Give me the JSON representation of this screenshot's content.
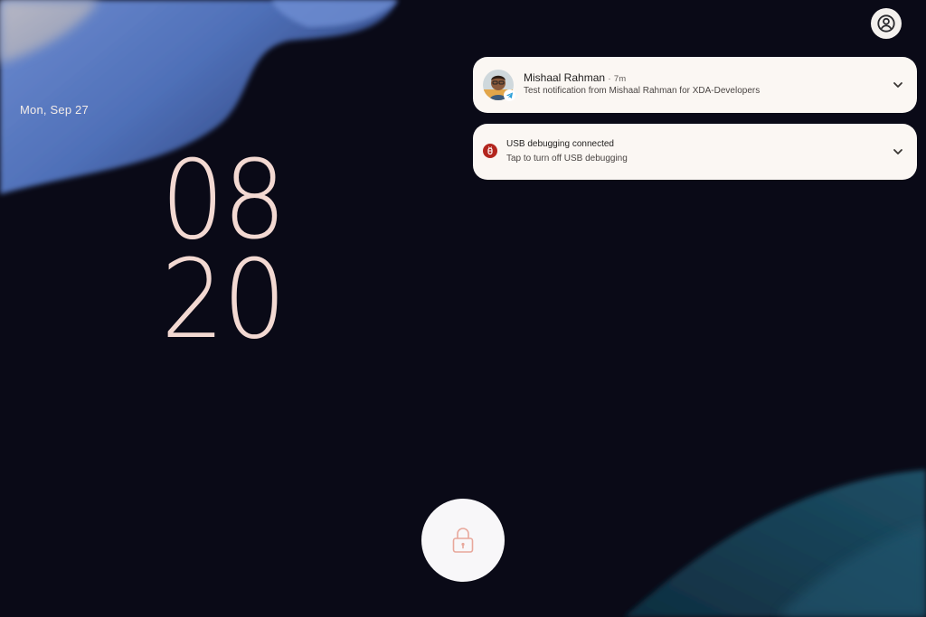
{
  "lockscreen": {
    "date": "Mon, Sep 27",
    "clock_hours": "08",
    "clock_minutes": "20"
  },
  "notifications": [
    {
      "sender": "Mishaal Rahman",
      "separator": "·",
      "time": "7m",
      "message": "Test notification from Mishaal Rahman for XDA-Developers",
      "icon": "avatar-icon",
      "badge_icon": "telegram-icon"
    },
    {
      "title": "USB debugging connected",
      "message": "Tap to turn off USB debugging",
      "icon": "usb-debug-icon",
      "icon_color": "#b3261e"
    }
  ],
  "icons": {
    "user": "user-circle-icon",
    "expand": "chevron-down-icon",
    "lock": "lock-icon"
  },
  "colors": {
    "clock": "#f3d9d2",
    "notification_bg": "#fbf7f3",
    "lock_accent": "#e8a79b"
  }
}
